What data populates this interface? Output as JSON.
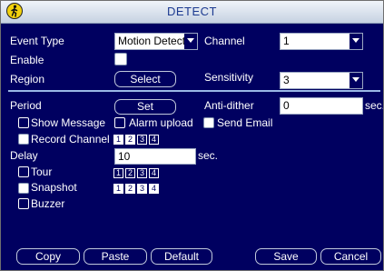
{
  "window": {
    "title": "DETECT"
  },
  "row1": {
    "event_type_label": "Event Type",
    "event_type_value": "Motion Detect",
    "channel_label": "Channel",
    "channel_value": "1"
  },
  "enable_label": "Enable",
  "region": {
    "label": "Region",
    "button": "Select",
    "sensitivity_label": "Sensitivity",
    "sensitivity_value": "3"
  },
  "period": {
    "label": "Period",
    "button": "Set",
    "anti_dither_label": "Anti-dither",
    "anti_dither_value": "0",
    "anti_dither_unit": "sec."
  },
  "options": {
    "show_message": "Show Message",
    "alarm_upload": "Alarm upload",
    "send_email": "Send Email",
    "record_channel": "Record Channel",
    "delay_label": "Delay",
    "delay_value": "10",
    "delay_unit": "sec.",
    "tour": "Tour",
    "snapshot": "Snapshot",
    "buzzer": "Buzzer"
  },
  "channel_groups": {
    "record": [
      {
        "label": "1",
        "on": true
      },
      {
        "label": "2",
        "on": true
      },
      {
        "label": "3",
        "on": false
      },
      {
        "label": "4",
        "on": false
      }
    ],
    "tour": [
      {
        "label": "1",
        "on": false
      },
      {
        "label": "2",
        "on": false
      },
      {
        "label": "3",
        "on": false
      },
      {
        "label": "4",
        "on": false
      }
    ],
    "snapshot": [
      {
        "label": "1",
        "on": true
      },
      {
        "label": "2",
        "on": true
      },
      {
        "label": "3",
        "on": true
      },
      {
        "label": "4",
        "on": true
      }
    ]
  },
  "buttons": {
    "copy": "Copy",
    "paste": "Paste",
    "default": "Default",
    "save": "Save",
    "cancel": "Cancel"
  },
  "colors": {
    "background": "#000060",
    "title_text": "#1c3a90",
    "divider": "#9ab8e6",
    "logo": "#f2d10d"
  },
  "icons": {
    "logo": "walking-person-logo-icon",
    "dropdown": "dropdown-arrow-icon"
  }
}
